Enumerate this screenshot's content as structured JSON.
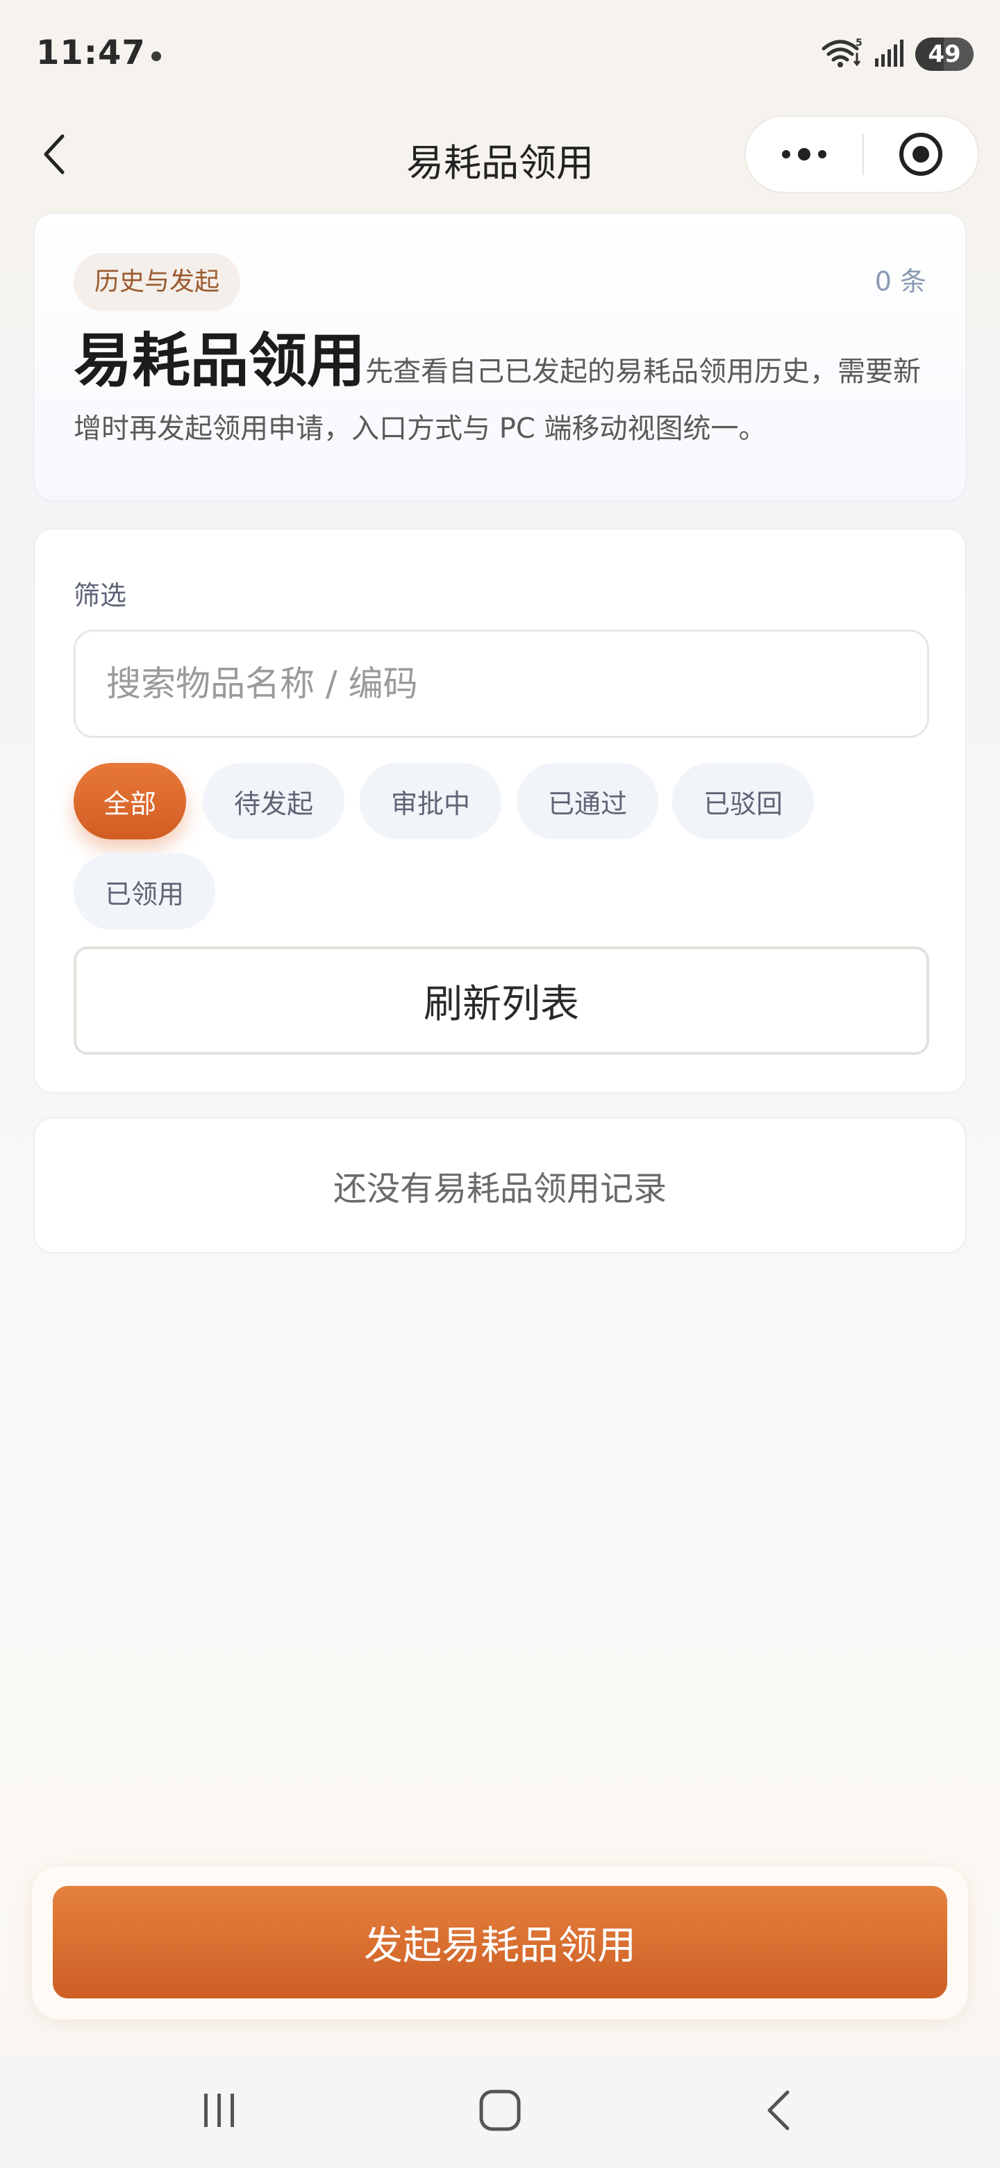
{
  "status_bar": {
    "time": "11:47",
    "battery": "49",
    "battery_level": 0.49,
    "icons": [
      "wifi-icon",
      "signal-icon",
      "battery-icon"
    ]
  },
  "nav": {
    "title": "易耗品领用",
    "icons": [
      "back-icon",
      "more-icon",
      "close-target-icon"
    ]
  },
  "header": {
    "tag": "历史与发起",
    "count": "0 条",
    "title": "易耗品领用",
    "description": "先查看自己已发起的易耗品领用历史，需要新增时再发起领用申请，入口方式与 PC 端移动视图统一。"
  },
  "filter": {
    "label": "筛选",
    "search_placeholder": "搜索物品名称 / 编码",
    "search_value": "",
    "chips": [
      {
        "label": "全部",
        "active": true
      },
      {
        "label": "待发起",
        "active": false
      },
      {
        "label": "审批中",
        "active": false
      },
      {
        "label": "已通过",
        "active": false
      },
      {
        "label": "已驳回",
        "active": false
      },
      {
        "label": "已领用",
        "active": false
      }
    ],
    "refresh_label": "刷新列表"
  },
  "empty": {
    "text": "还没有易耗品领用记录"
  },
  "action": {
    "primary_label": "发起易耗品领用"
  },
  "system_nav": {
    "icons": [
      "recents-icon",
      "home-icon",
      "system-back-icon"
    ]
  },
  "colors": {
    "accent": "#d9692d",
    "tag_bg": "#f4efea",
    "tag_text": "#9a5a2e",
    "chip_bg": "#f1f4f9"
  }
}
